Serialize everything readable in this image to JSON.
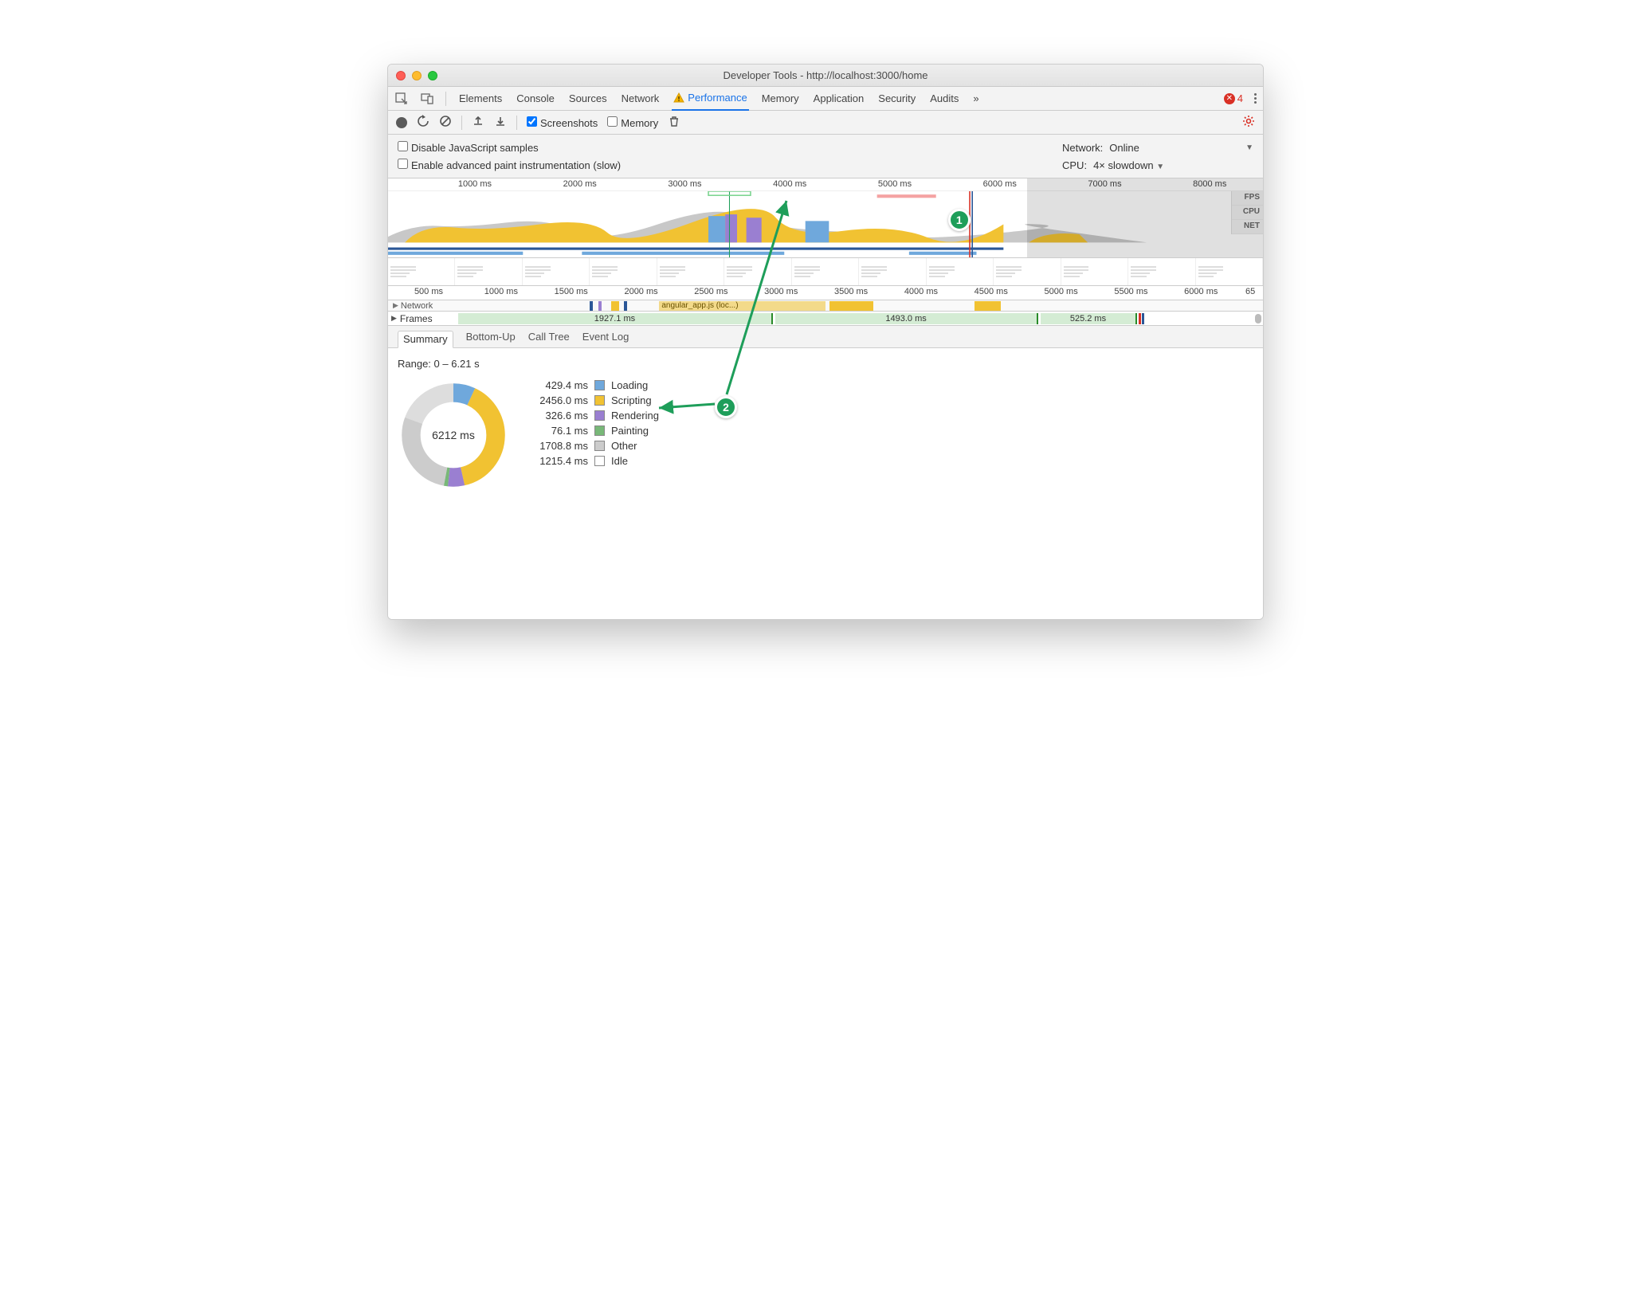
{
  "window": {
    "title": "Developer Tools - http://localhost:3000/home"
  },
  "tabs": {
    "items": [
      "Elements",
      "Console",
      "Sources",
      "Network",
      "Performance",
      "Memory",
      "Application",
      "Security",
      "Audits"
    ],
    "active": "Performance",
    "errors": "4",
    "overflow": "»"
  },
  "toolbar": {
    "screenshots_label": "Screenshots",
    "memory_label": "Memory"
  },
  "options": {
    "disable_js": "Disable JavaScript samples",
    "enable_paint": "Enable advanced paint instrumentation (slow)",
    "network_label": "Network:",
    "network_value": "Online",
    "cpu_label": "CPU:",
    "cpu_value": "4× slowdown"
  },
  "overview": {
    "ticks": [
      "1000 ms",
      "2000 ms",
      "3000 ms",
      "4000 ms",
      "5000 ms",
      "6000 ms",
      "7000 ms",
      "8000 ms"
    ],
    "labels": {
      "fps": "FPS",
      "cpu": "CPU",
      "net": "NET"
    }
  },
  "timeline2": {
    "ticks": [
      "500 ms",
      "1000 ms",
      "1500 ms",
      "2000 ms",
      "2500 ms",
      "3000 ms",
      "3500 ms",
      "4000 ms",
      "4500 ms",
      "5000 ms",
      "5500 ms",
      "6000 ms",
      "65"
    ]
  },
  "network_row": {
    "label": "Network",
    "file_hint": "angular_app.js (loc...)"
  },
  "frames": {
    "label": "Frames",
    "bars": [
      "1927.1 ms",
      "1493.0 ms",
      "525.2 ms"
    ]
  },
  "detail_tabs": [
    "Summary",
    "Bottom-Up",
    "Call Tree",
    "Event Log"
  ],
  "summary": {
    "range": "Range: 0 – 6.21 s",
    "total": "6212 ms",
    "legend": [
      {
        "time": "429.4 ms",
        "label": "Loading",
        "color": "#6fa8dc"
      },
      {
        "time": "2456.0 ms",
        "label": "Scripting",
        "color": "#f1c232"
      },
      {
        "time": "326.6 ms",
        "label": "Rendering",
        "color": "#9a7fd1"
      },
      {
        "time": "76.1 ms",
        "label": "Painting",
        "color": "#78b878"
      },
      {
        "time": "1708.8 ms",
        "label": "Other",
        "color": "#cccccc"
      },
      {
        "time": "1215.4 ms",
        "label": "Idle",
        "color": "#ffffff"
      }
    ]
  },
  "annotations": {
    "a1": "1",
    "a2": "2"
  },
  "chart_data": {
    "type": "pie",
    "title": "Summary",
    "total_ms": 6212,
    "series": [
      {
        "name": "Loading",
        "value": 429.4,
        "color": "#6fa8dc"
      },
      {
        "name": "Scripting",
        "value": 2456.0,
        "color": "#f1c232"
      },
      {
        "name": "Rendering",
        "value": 326.6,
        "color": "#9a7fd1"
      },
      {
        "name": "Painting",
        "value": 76.1,
        "color": "#78b878"
      },
      {
        "name": "Other",
        "value": 1708.8,
        "color": "#cccccc"
      },
      {
        "name": "Idle",
        "value": 1215.4,
        "color": "#ffffff"
      }
    ]
  }
}
